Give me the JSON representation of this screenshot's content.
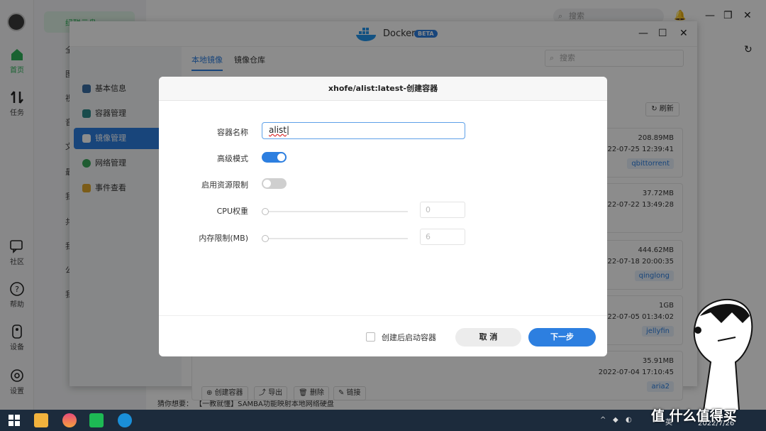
{
  "rail": {
    "items": [
      {
        "label": "首页",
        "icon": "home-icon"
      },
      {
        "label": "任务",
        "icon": "transfer-icon"
      },
      {
        "label": "社区",
        "icon": "chat-icon"
      },
      {
        "label": "帮助",
        "icon": "help-icon"
      },
      {
        "label": "设备",
        "icon": "device-icon"
      },
      {
        "label": "设置",
        "icon": "gear-icon"
      }
    ]
  },
  "background": {
    "search_placeholder": "搜索",
    "nav_active": "绿联云盘",
    "frags": [
      "全",
      "图",
      "视",
      "音",
      "文",
      "最",
      "我",
      "共",
      "我",
      "公",
      "我"
    ],
    "notice": "猜你想要：  【一教就懂】SAMBA功能映射本地网络硬盘"
  },
  "docker": {
    "title": "Docker",
    "badge": "BETA",
    "nav": [
      {
        "label": "基本信息",
        "color": "#3a6ea5"
      },
      {
        "label": "容器管理",
        "color": "#2e8b8b"
      },
      {
        "label": "镜像管理",
        "color": "#ffffff",
        "active": true
      },
      {
        "label": "网络管理",
        "color": "#3aa85a"
      },
      {
        "label": "事件查看",
        "color": "#e0a82d"
      }
    ],
    "tabs": [
      "本地镜像",
      "镜像仓库"
    ],
    "search_placeholder": "搜索",
    "refresh_label": "刷新",
    "images": [
      {
        "size": "208.89MB",
        "date": "2022-07-25 12:39:41",
        "tag": "qbittorrent"
      },
      {
        "size": "37.72MB",
        "date": "2022-07-22 13:49:28",
        "tag": ""
      },
      {
        "size": "444.62MB",
        "date": "2022-07-18 20:00:35",
        "tag": "qinglong"
      },
      {
        "size": "1GB",
        "date": "2022-07-05 01:34:02",
        "tag": "jellyfin"
      },
      {
        "size": "35.91MB",
        "date": "2022-07-04 17:10:45",
        "tag": "aria2"
      }
    ],
    "toolbar": [
      "创建容器",
      "导出",
      "删除",
      "链接"
    ]
  },
  "modal": {
    "title": "xhofe/alist:latest-创建容器",
    "fields": {
      "name_label": "容器名称",
      "name_value": "alist",
      "advanced_label": "高级模式",
      "advanced_on": true,
      "limit_label": "启用资源限制",
      "limit_on": false,
      "cpu_label": "CPU权重",
      "cpu_value": "0",
      "mem_label": "内存限制(MB)",
      "mem_value": "6"
    },
    "autostart_label": "创建后启动容器",
    "cancel_label": "取 消",
    "next_label": "下一步"
  },
  "taskbar": {
    "tray_lang": "英",
    "date": "2022/7/26"
  },
  "watermark": "值 什么值得买",
  "colors": {
    "accent": "#2d7fe0",
    "green": "#28a745"
  }
}
